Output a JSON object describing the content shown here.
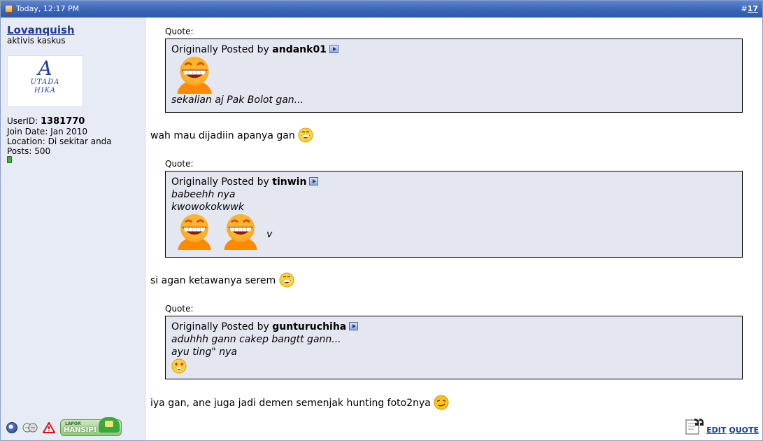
{
  "header": {
    "date": "Today, 12:17 PM",
    "post_number_prefix": "#",
    "post_number": "17"
  },
  "user": {
    "name": "Lovanquish",
    "title": "aktivis kaskus",
    "avatar_text_big": "A",
    "avatar_text_line1": "UTADA",
    "avatar_text_line2": "HIKA",
    "userid_label": "UserID:",
    "userid": "1381770",
    "join_date": "Join Date: Jan 2010",
    "location": "Location: Di sekitar anda",
    "posts": "Posts: 500",
    "hansip_small": "LAPOR",
    "hansip_big": "HANSIP!"
  },
  "quotes": [
    {
      "label": "Quote:",
      "prefix": "Originally Posted by",
      "author": "andank01",
      "lines": [
        "sekalian aj Pak Bolot gan..."
      ]
    },
    {
      "label": "Quote:",
      "prefix": "Originally Posted by",
      "author": "tinwin",
      "lines": [
        "babeehh nya",
        "kwowokokwwk"
      ],
      "after_smileys": "v"
    },
    {
      "label": "Quote:",
      "prefix": "Originally Posted by",
      "author": "gunturuchiha",
      "lines": [
        "aduhhh gann cakep bangtt gann...",
        "ayu ting\" nya"
      ]
    }
  ],
  "messages": [
    "wah mau dijadiin apanya gan",
    "si agan ketawanya serem",
    "iya gan, ane juga jadi demen semenjak hunting foto2nya"
  ],
  "actions": {
    "edit": "EDIT",
    "quote": "QUOTE"
  }
}
